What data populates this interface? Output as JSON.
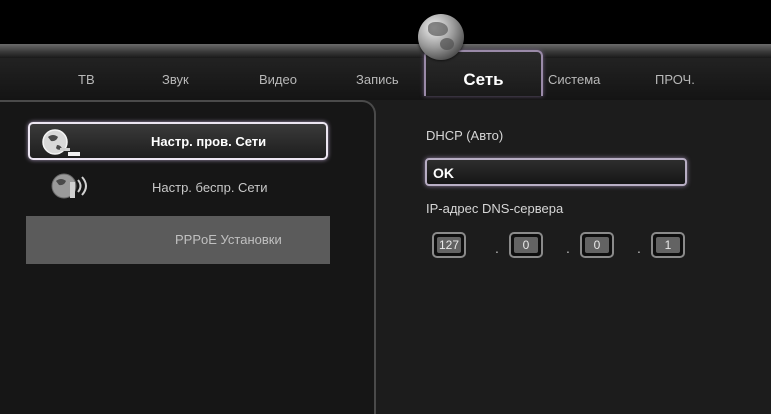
{
  "tabs": [
    {
      "label": "ТВ"
    },
    {
      "label": "Звук"
    },
    {
      "label": "Видео"
    },
    {
      "label": "Запись"
    },
    {
      "label": "Сеть",
      "active": true
    },
    {
      "label": "Система"
    },
    {
      "label": "ПРОЧ."
    }
  ],
  "menu": {
    "items": [
      {
        "label": "Настр. пров. Сети",
        "icon": "wired-network-icon",
        "state": "selected"
      },
      {
        "label": "Настр. беспр. Сети",
        "icon": "wireless-network-icon",
        "state": "normal"
      },
      {
        "label": "PPPoE Установки",
        "state": "disabled"
      }
    ]
  },
  "settings": {
    "mode_label": "DHCP  (Авто)",
    "ok_value": "OK",
    "dns_label": "IP-адрес DNS-сервера",
    "dns_octets": [
      "127",
      "0",
      "0",
      "1"
    ]
  },
  "colors": {
    "highlight_border": "#ece6f2",
    "glow": "#9a8aa8",
    "disabled_item": "#5b5b5b"
  }
}
